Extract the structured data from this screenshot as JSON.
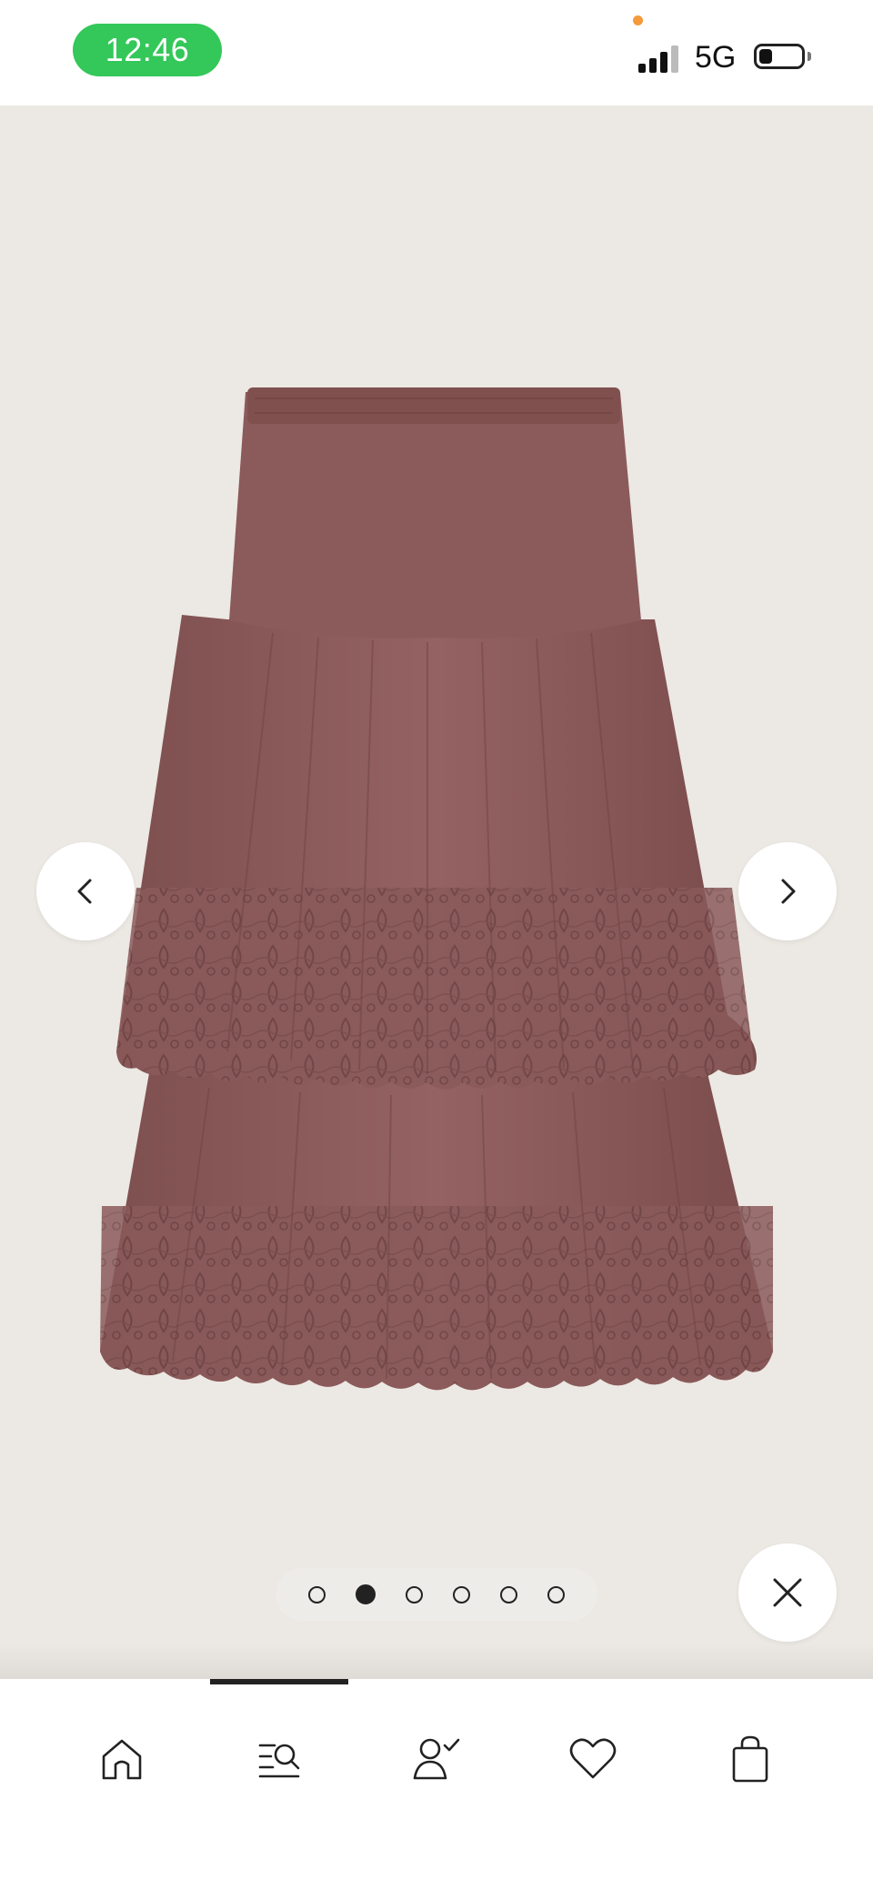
{
  "status_bar": {
    "time": "12:46",
    "network": "5G",
    "colors": {
      "time_pill": "#34c759",
      "indicator_dot": "#f59a3a"
    }
  },
  "gallery": {
    "image_icon": "product-photo-skirt",
    "image_count": 6,
    "active_index": 1,
    "prev_icon": "chevron-left-icon",
    "next_icon": "chevron-right-icon",
    "close_icon": "close-icon",
    "colors": {
      "background": "#ece8e3",
      "product": "#8a5858"
    }
  },
  "bottom_nav": {
    "active_index": 1,
    "items": [
      {
        "icon": "home-icon"
      },
      {
        "icon": "search-list-icon"
      },
      {
        "icon": "account-icon"
      },
      {
        "icon": "heart-icon"
      },
      {
        "icon": "bag-icon"
      }
    ]
  }
}
